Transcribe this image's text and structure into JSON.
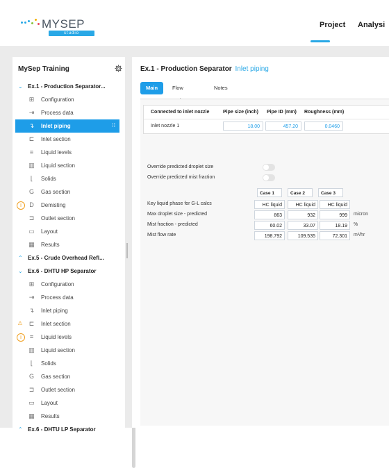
{
  "app": {
    "logo_text": "MYSEP",
    "logo_sub": "studio",
    "nav": {
      "project": "Project",
      "analysis": "Analysi"
    }
  },
  "sidebar": {
    "title": "MySep Training",
    "items": [
      {
        "type": "group",
        "label": "Ex.1 - Production Separator...",
        "expanded": true
      },
      {
        "type": "item",
        "label": "Configuration",
        "icon": "configuration-icon",
        "glyph": "⊞"
      },
      {
        "type": "item",
        "label": "Process data",
        "icon": "process-data-icon",
        "glyph": "⇥"
      },
      {
        "type": "item",
        "label": "Inlet piping",
        "icon": "inlet-piping-icon",
        "glyph": "↴",
        "active": true
      },
      {
        "type": "item",
        "label": "Inlet section",
        "icon": "inlet-section-icon",
        "glyph": "⊏"
      },
      {
        "type": "item",
        "label": "Liquid levels",
        "icon": "liquid-levels-icon",
        "glyph": "≡"
      },
      {
        "type": "item",
        "label": "Liquid section",
        "icon": "liquid-section-icon",
        "glyph": "▥"
      },
      {
        "type": "item",
        "label": "Solids",
        "icon": "solids-icon",
        "glyph": "⌊"
      },
      {
        "type": "item",
        "label": "Gas section",
        "icon": "gas-section-icon",
        "glyph": "G"
      },
      {
        "type": "item",
        "label": "Demisting",
        "icon": "demisting-icon",
        "glyph": "D",
        "status": "info"
      },
      {
        "type": "item",
        "label": "Outlet section",
        "icon": "outlet-section-icon",
        "glyph": "⊐"
      },
      {
        "type": "item",
        "label": "Layout",
        "icon": "layout-icon",
        "glyph": "▭"
      },
      {
        "type": "item",
        "label": "Results",
        "icon": "results-icon",
        "glyph": "▦"
      },
      {
        "type": "group",
        "label": "Ex.5 - Crude Overhead Refl...",
        "expanded": false
      },
      {
        "type": "group",
        "label": "Ex.6 - DHTU HP Separator",
        "expanded": true
      },
      {
        "type": "item",
        "label": "Configuration",
        "icon": "configuration-icon",
        "glyph": "⊞"
      },
      {
        "type": "item",
        "label": "Process data",
        "icon": "process-data-icon",
        "glyph": "⇥"
      },
      {
        "type": "item",
        "label": "Inlet piping",
        "icon": "inlet-piping-icon",
        "glyph": "↴"
      },
      {
        "type": "item",
        "label": "Inlet section",
        "icon": "inlet-section-icon",
        "glyph": "⊏",
        "status": "warn"
      },
      {
        "type": "item",
        "label": "Liquid levels",
        "icon": "liquid-levels-icon",
        "glyph": "≡",
        "status": "info"
      },
      {
        "type": "item",
        "label": "Liquid section",
        "icon": "liquid-section-icon",
        "glyph": "▥"
      },
      {
        "type": "item",
        "label": "Solids",
        "icon": "solids-icon",
        "glyph": "⌊"
      },
      {
        "type": "item",
        "label": "Gas section",
        "icon": "gas-section-icon",
        "glyph": "G"
      },
      {
        "type": "item",
        "label": "Outlet section",
        "icon": "outlet-section-icon",
        "glyph": "⊐"
      },
      {
        "type": "item",
        "label": "Layout",
        "icon": "layout-icon",
        "glyph": "▭"
      },
      {
        "type": "item",
        "label": "Results",
        "icon": "results-icon",
        "glyph": "▦"
      },
      {
        "type": "group",
        "label": "Ex.6 - DHTU LP Separator",
        "expanded": false
      }
    ]
  },
  "main": {
    "title_bold": "Ex.1 - Production Separator",
    "title_sub": "Inlet piping",
    "tabs": [
      "Main",
      "Flow regime",
      "Notes"
    ],
    "pipe_table": {
      "headers": [
        "Connected to inlet nozzle",
        "Pipe size (inch)",
        "Pipe ID (mm)",
        "Roughness (mm)"
      ],
      "row": {
        "label": "Inlet nozzle 1",
        "pipe_size": "18.00",
        "pipe_id": "457.20",
        "roughness": "0.0460"
      }
    },
    "options": [
      {
        "label": "Override predicted droplet size",
        "on": false
      },
      {
        "label": "Override predicted mist fraction",
        "on": false
      }
    ],
    "cases": {
      "headers": [
        "Case 1",
        "Case 2",
        "Case 3"
      ],
      "rows": [
        {
          "label": "Key liquid phase for G-L calcs",
          "values": [
            "HC liquid",
            "HC liquid",
            "HC liquid"
          ],
          "unit": ""
        },
        {
          "label": "Max droplet size - predicted",
          "values": [
            "863",
            "932",
            "999"
          ],
          "unit": "micron"
        },
        {
          "label": "Mist fraction - predicted",
          "values": [
            "60.02",
            "33.07",
            "18.19"
          ],
          "unit": "%"
        },
        {
          "label": "Mist flow rate",
          "values": [
            "198.792",
            "109.535",
            "72.301"
          ],
          "unit": "m³/hr"
        }
      ]
    }
  },
  "colors": {
    "accent": "#1e9de8",
    "warn": "#f0a020",
    "info": "#f0a020"
  }
}
